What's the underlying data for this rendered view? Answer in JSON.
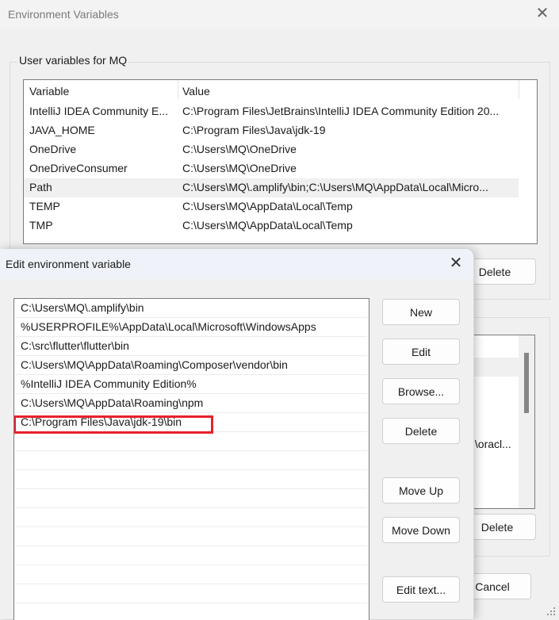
{
  "env_window": {
    "title": "Environment Variables",
    "close_icon": "close-icon",
    "user_group_label": "User variables for MQ",
    "user_table": {
      "columns": [
        "Variable",
        "Value"
      ],
      "rows": [
        {
          "variable": "IntelliJ IDEA Community E...",
          "value": "C:\\Program Files\\JetBrains\\IntelliJ IDEA Community Edition 20..."
        },
        {
          "variable": "JAVA_HOME",
          "value": "C:\\Program Files\\Java\\jdk-19"
        },
        {
          "variable": "OneDrive",
          "value": "C:\\Users\\MQ\\OneDrive"
        },
        {
          "variable": "OneDriveConsumer",
          "value": "C:\\Users\\MQ\\OneDrive"
        },
        {
          "variable": "Path",
          "value": "C:\\Users\\MQ\\.amplify\\bin;C:\\Users\\MQ\\AppData\\Local\\Micro...",
          "selected": true
        },
        {
          "variable": "TEMP",
          "value": "C:\\Users\\MQ\\AppData\\Local\\Temp"
        },
        {
          "variable": "TMP",
          "value": "C:\\Users\\MQ\\AppData\\Local\\Temp"
        }
      ]
    },
    "user_delete_label": "Delete",
    "system_partial_text": ":\\oracl...",
    "system_delete_label": "Delete",
    "cancel_label": "Cancel"
  },
  "edit_dialog": {
    "title": "Edit environment variable",
    "close_icon": "close-icon",
    "paths": [
      "C:\\Users\\MQ\\.amplify\\bin",
      "%USERPROFILE%\\AppData\\Local\\Microsoft\\WindowsApps",
      "C:\\src\\flutter\\flutter\\bin",
      "C:\\Users\\MQ\\AppData\\Roaming\\Composer\\vendor\\bin",
      "%IntelliJ IDEA Community Edition%",
      "C:\\Users\\MQ\\AppData\\Roaming\\npm",
      "C:\\Program Files\\Java\\jdk-19\\bin"
    ],
    "highlighted_index": 6,
    "highlight_color": "#e8202a",
    "buttons": {
      "new": "New",
      "edit": "Edit",
      "browse": "Browse...",
      "delete": "Delete",
      "move_up": "Move Up",
      "move_down": "Move Down",
      "edit_text": "Edit text..."
    }
  }
}
